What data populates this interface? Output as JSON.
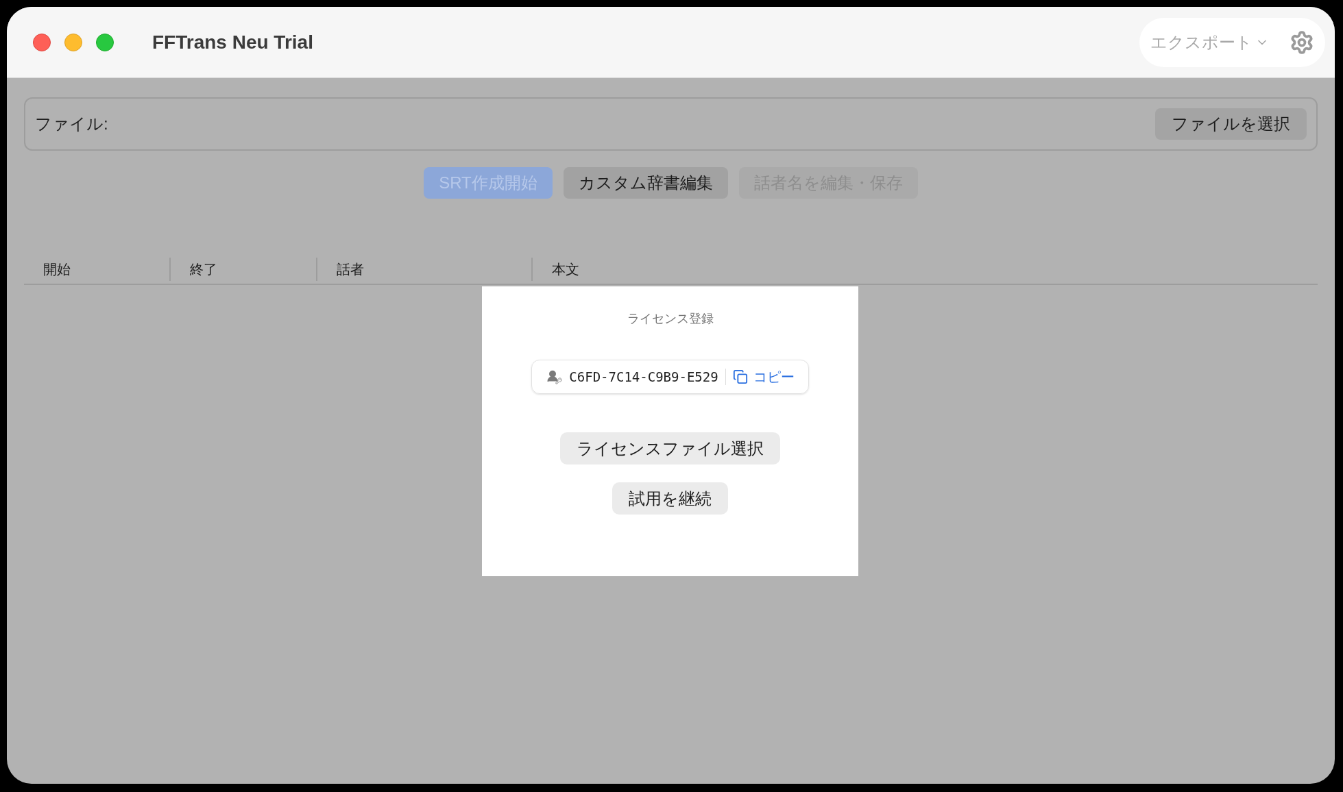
{
  "window": {
    "title": "FFTrans Neu Trial"
  },
  "toolbar": {
    "export_label": "エクスポート"
  },
  "file_picker": {
    "label": "ファイル:",
    "button": "ファイルを選択"
  },
  "actions": [
    {
      "label": "SRT作成開始",
      "kind": "primary",
      "disabled": true
    },
    {
      "label": "カスタム辞書編集",
      "kind": "default",
      "disabled": false
    },
    {
      "label": "話者名を編集・保存",
      "kind": "default",
      "disabled": true
    }
  ],
  "table": {
    "columns": [
      "開始",
      "終了",
      "話者",
      "本文"
    ]
  },
  "dialog": {
    "title": "ライセンス登録",
    "license_key": "C6FD-7C14-C9B9-E529",
    "copy_label": "コピー",
    "buttons": [
      "ライセンスファイル選択",
      "試用を継続"
    ]
  }
}
